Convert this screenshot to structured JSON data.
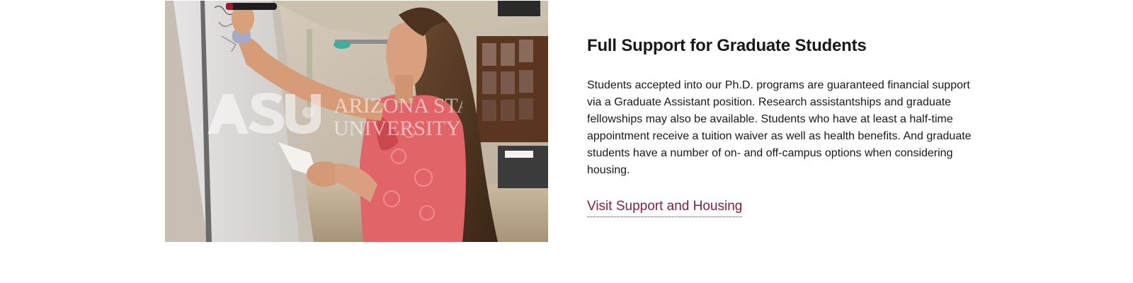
{
  "image": {
    "alt_label": "ASU graduate student writing on whiteboard",
    "watermark_text": [
      "ARIZONA STATE",
      "UNIVERSITY"
    ]
  },
  "card": {
    "heading": "Full Support for Graduate Students",
    "body": "Students accepted into our Ph.D. programs are guaranteed financial support via a Graduate Assistant position. Research assistantships and graduate fellowships may also be available. Students who have at least a half-time appointment receive a tuition waiver as well as health benefits. And graduate students have a number of on- and off-campus options when considering housing.",
    "link_label": "Visit Support and Housing"
  },
  "colors": {
    "accent_maroon": "#8c1d40",
    "text": "#191919",
    "background": "#ffffff"
  }
}
